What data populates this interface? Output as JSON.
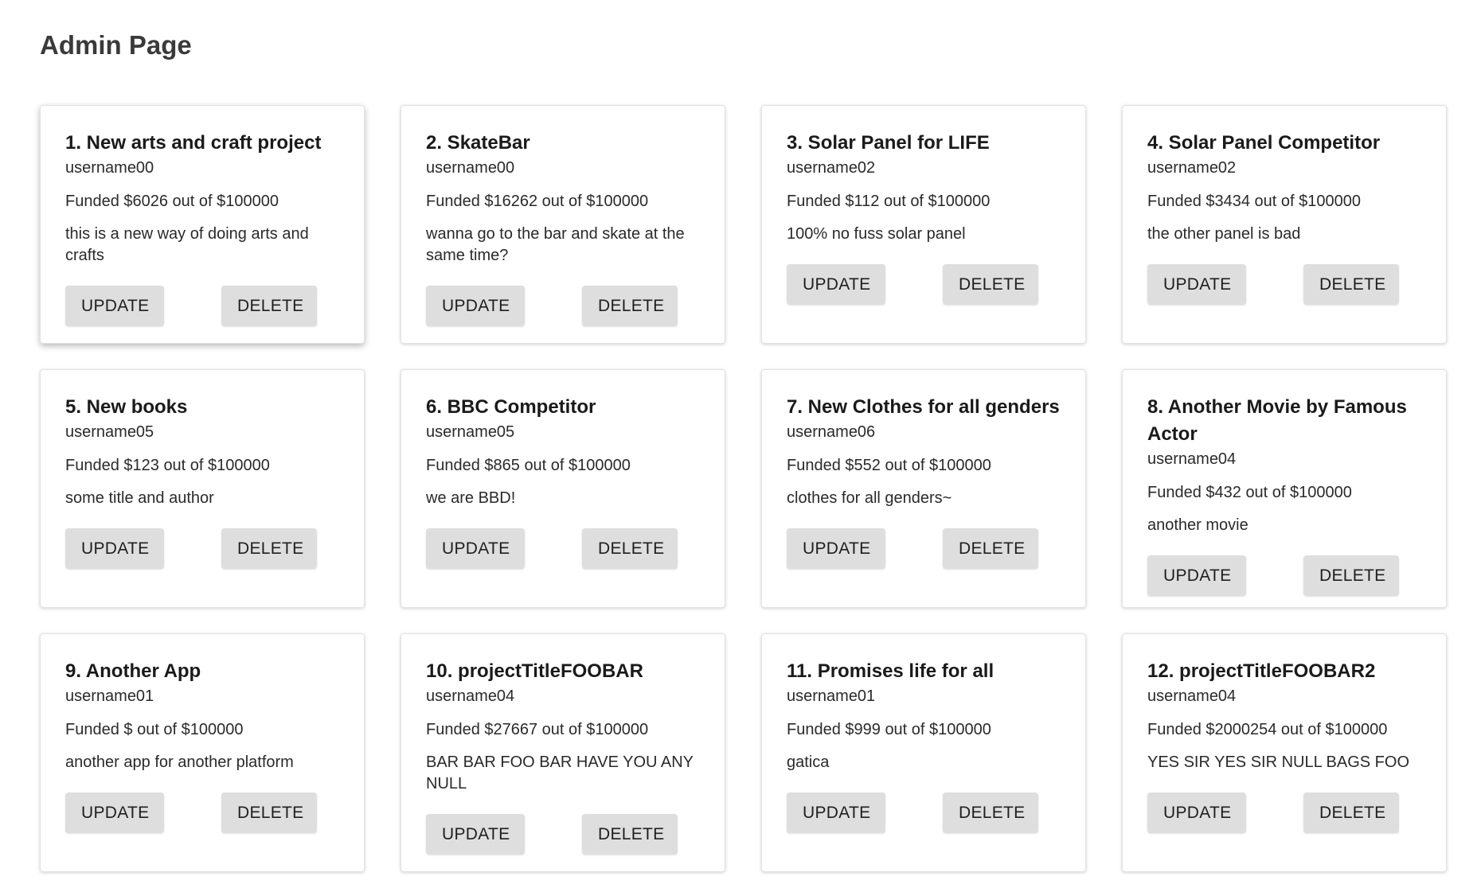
{
  "page": {
    "title": "Admin Page"
  },
  "labels": {
    "update": "UPDATE",
    "delete": "DELETE"
  },
  "projects": [
    {
      "title": "1. New arts and craft project",
      "user": "username00",
      "funded": "Funded $6026 out of $100000",
      "description": "this is a new way of doing arts and crafts"
    },
    {
      "title": "2. SkateBar",
      "user": "username00",
      "funded": "Funded $16262 out of $100000",
      "description": "wanna go to the bar and skate at the same time?"
    },
    {
      "title": "3. Solar Panel for LIFE",
      "user": "username02",
      "funded": "Funded $112 out of $100000",
      "description": "100% no fuss solar panel"
    },
    {
      "title": "4. Solar Panel Competitor",
      "user": "username02",
      "funded": "Funded $3434 out of $100000",
      "description": "the other panel is bad"
    },
    {
      "title": "5. New books",
      "user": "username05",
      "funded": "Funded $123 out of $100000",
      "description": "some title and author"
    },
    {
      "title": "6. BBC Competitor",
      "user": "username05",
      "funded": "Funded $865 out of $100000",
      "description": "we are BBD!"
    },
    {
      "title": "7. New Clothes for all genders",
      "user": "username06",
      "funded": "Funded $552 out of $100000",
      "description": "clothes for all genders~"
    },
    {
      "title": "8. Another Movie by Famous Actor",
      "user": "username04",
      "funded": "Funded $432 out of $100000",
      "description": "another movie"
    },
    {
      "title": "9. Another App",
      "user": "username01",
      "funded": "Funded $ out of $100000",
      "description": "another app for another platform"
    },
    {
      "title": "10. projectTitleFOOBAR",
      "user": "username04",
      "funded": "Funded $27667 out of $100000",
      "description": "BAR BAR FOO BAR HAVE YOU ANY NULL"
    },
    {
      "title": "11. Promises life for all",
      "user": "username01",
      "funded": "Funded $999 out of $100000",
      "description": "gatica"
    },
    {
      "title": "12. projectTitleFOOBAR2",
      "user": "username04",
      "funded": "Funded $2000254 out of $100000",
      "description": "YES SIR YES SIR NULL BAGS FOO"
    }
  ]
}
